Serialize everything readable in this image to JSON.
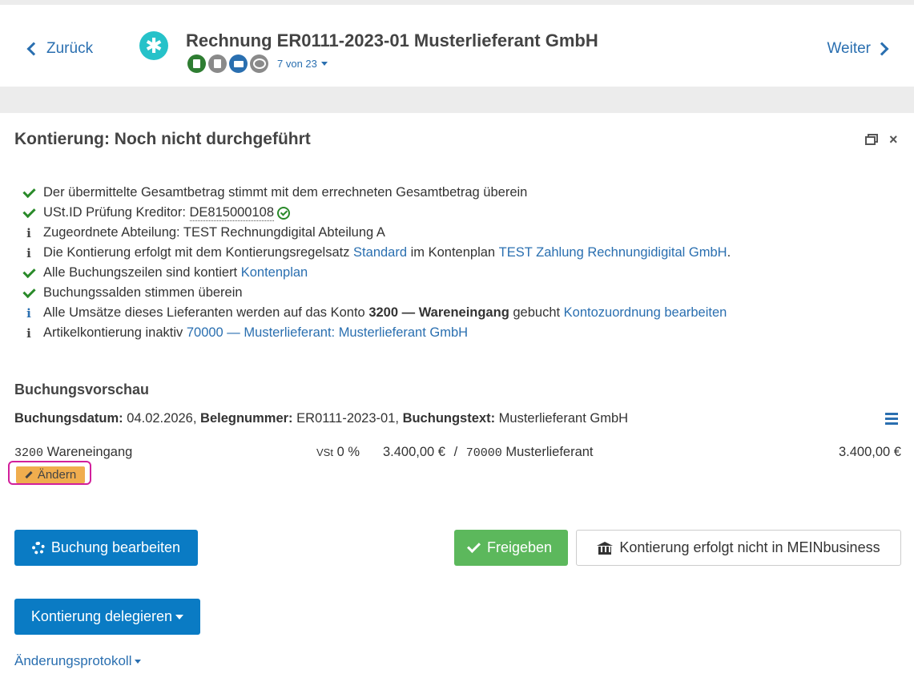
{
  "header": {
    "back_label": "Zurück",
    "next_label": "Weiter",
    "logo_glyph": "✱",
    "title": "Rechnung ER0111-2023-01 Musterlieferant GmbH",
    "counter": "7 von 23",
    "doc_icons": [
      "document-icon",
      "book-icon",
      "money-icon",
      "comment-icon"
    ]
  },
  "panel": {
    "title": "Kontierung: Noch nicht durchgeführt",
    "close_glyph": "×"
  },
  "checks": [
    {
      "icon": "check-icon",
      "text": "Der übermittelte Gesamtbetrag stimmt mit dem errechneten Gesamtbetrag überein"
    },
    {
      "icon": "check-icon",
      "prefix": "USt.ID Prüfung Kreditor: ",
      "value": "DE815000108"
    },
    {
      "icon": "info-icon",
      "text": "Zugeordnete Abteilung: TEST Rechnungdigital Abteilung A"
    },
    {
      "icon": "info-icon",
      "prefix": "Die Kontierung erfolgt mit dem Kontierungsregelsatz ",
      "link1": "Standard",
      "middle": " im Kontenplan ",
      "link2": "TEST Zahlung Rechnungidigital GmbH",
      "suffix": "."
    },
    {
      "icon": "check-icon",
      "prefix": "Alle Buchungszeilen sind kontiert ",
      "link": "Kontenplan"
    },
    {
      "icon": "check-icon",
      "text": "Buchungssalden stimmen überein"
    },
    {
      "icon": "info-icon",
      "prefix": "Alle Umsätze dieses Lieferanten werden auf das Konto ",
      "bold": "3200 — Wareneingang",
      "middle": " gebucht ",
      "link": "Kontozuordnung bearbeiten"
    },
    {
      "icon": "info-icon",
      "prefix": "Artikelkontierung inaktiv ",
      "link": "70000 — Musterlieferant: Musterlieferant GmbH"
    }
  ],
  "preview": {
    "title": "Buchungsvorschau",
    "date_label": "Buchungsdatum:",
    "date": "04.02.2026,",
    "beleg_label": "Belegnummer:",
    "beleg": "ER0111-2023-01,",
    "text_label": "Buchungstext:",
    "text": "Musterlieferant GmbH"
  },
  "booking": {
    "account": "3200",
    "account_name": "Wareneingang",
    "tax_label": "VSt",
    "tax_rate": "0 %",
    "amount": "3.400,00 €",
    "separator": "/",
    "counter_account": "70000",
    "counter_name": "Musterlieferant",
    "total": "3.400,00 €",
    "change_label": "Ändern"
  },
  "buttons": {
    "edit": "Buchung bearbeiten",
    "release": "Freigeben",
    "external": "Kontierung erfolgt nicht in MEINbusiness",
    "delegate": "Kontierung delegieren"
  },
  "protocol_label": "Änderungsprotokoll"
}
